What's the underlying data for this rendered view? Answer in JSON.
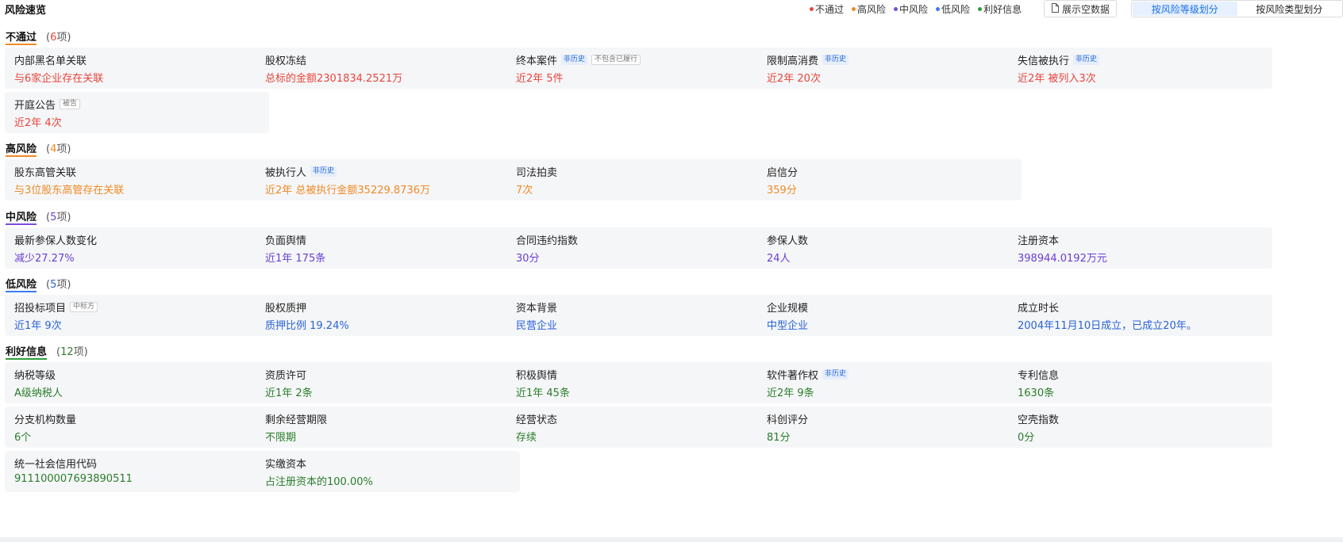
{
  "header": {
    "title": "风险速览",
    "legend": [
      {
        "label": "不通过",
        "color": "#e8453c"
      },
      {
        "label": "高风险",
        "color": "#f08a24"
      },
      {
        "label": "中风险",
        "color": "#7b4de0"
      },
      {
        "label": "低风险",
        "color": "#3a7bf0"
      },
      {
        "label": "利好信息",
        "color": "#2e9e3a"
      }
    ],
    "show_empty_label": "展示空数据",
    "view_tabs": [
      {
        "label": "按风险等级划分",
        "active": true
      },
      {
        "label": "按风险类型划分",
        "active": false
      }
    ]
  },
  "sections": [
    {
      "name": "不通过",
      "count_text": "(6项)",
      "count_open": "(",
      "count_num": "6",
      "count_close": "项)",
      "color": "#e8453c",
      "underline": "#f08a24",
      "items": [
        {
          "title": "内部黑名单关联",
          "value": "与6家企业存在关联"
        },
        {
          "title": "股权冻结",
          "value": "总标的金额2301834.2521万"
        },
        {
          "title": "终本案件",
          "tag": "非历史",
          "tag2": "不包含已履行",
          "value": "近2年 5件"
        },
        {
          "title": "限制高消费",
          "tag": "非历史",
          "value": "近2年 20次"
        },
        {
          "title": "失信被执行",
          "tag": "非历史",
          "value": "近2年 被列入3次"
        },
        {
          "title": "开庭公告",
          "tag2": "被告",
          "value": "近2年 4次"
        }
      ]
    },
    {
      "name": "高风险",
      "count_open": "(",
      "count_num": "4",
      "count_close": "项)",
      "color": "#f08a24",
      "underline": "#f08a24",
      "items": [
        {
          "title": "股东高管关联",
          "value": "与3位股东高管存在关联"
        },
        {
          "title": "被执行人",
          "tag": "非历史",
          "value": "近2年 总被执行金额35229.8736万"
        },
        {
          "title": "司法拍卖",
          "value": "7次"
        },
        {
          "title": "启信分",
          "value": "359分"
        }
      ]
    },
    {
      "name": "中风险",
      "count_open": "(",
      "count_num": "5",
      "count_close": "项)",
      "color": "#6a3fd6",
      "underline": "#7b4de0",
      "items": [
        {
          "title": "最新参保人数变化",
          "value": "减少27.27%"
        },
        {
          "title": "负面舆情",
          "value": "近1年 175条"
        },
        {
          "title": "合同违约指数",
          "value": "30分"
        },
        {
          "title": "参保人数",
          "value": "24人"
        },
        {
          "title": "注册资本",
          "value": "398944.0192万元"
        }
      ]
    },
    {
      "name": "低风险",
      "count_open": "(",
      "count_num": "5",
      "count_close": "项)",
      "color": "#2a63d8",
      "underline": "#3a7bf0",
      "items": [
        {
          "title": "招投标项目",
          "tag2": "中标方",
          "value": "近1年 9次"
        },
        {
          "title": "股权质押",
          "value": "质押比例 19.24%"
        },
        {
          "title": "资本背景",
          "value": "民营企业"
        },
        {
          "title": "企业规模",
          "value": "中型企业"
        },
        {
          "title": "成立时长",
          "value": "2004年11月10日成立，已成立20年。"
        }
      ]
    },
    {
      "name": "利好信息",
      "count_open": "(",
      "count_num": "12",
      "count_close": "项)",
      "color": "#2a7d2a",
      "underline": "#2e9e3a",
      "items": [
        {
          "title": "纳税等级",
          "value": "A级纳税人"
        },
        {
          "title": "资质许可",
          "value": "近1年 2条"
        },
        {
          "title": "积极舆情",
          "value": "近1年 45条"
        },
        {
          "title": "软件著作权",
          "tag": "非历史",
          "value": "近2年 9条"
        },
        {
          "title": "专利信息",
          "value": "1630条"
        },
        {
          "title": "分支机构数量",
          "value": "6个"
        },
        {
          "title": "剩余经营期限",
          "value": "不限期"
        },
        {
          "title": "经营状态",
          "value": "存续"
        },
        {
          "title": "科创评分",
          "value": "81分"
        },
        {
          "title": "空壳指数",
          "value": "0分"
        },
        {
          "title": "统一社会信用代码",
          "value": "911100007693890511"
        },
        {
          "title": "实缴资本",
          "value": "占注册资本的100.00%"
        }
      ]
    }
  ]
}
